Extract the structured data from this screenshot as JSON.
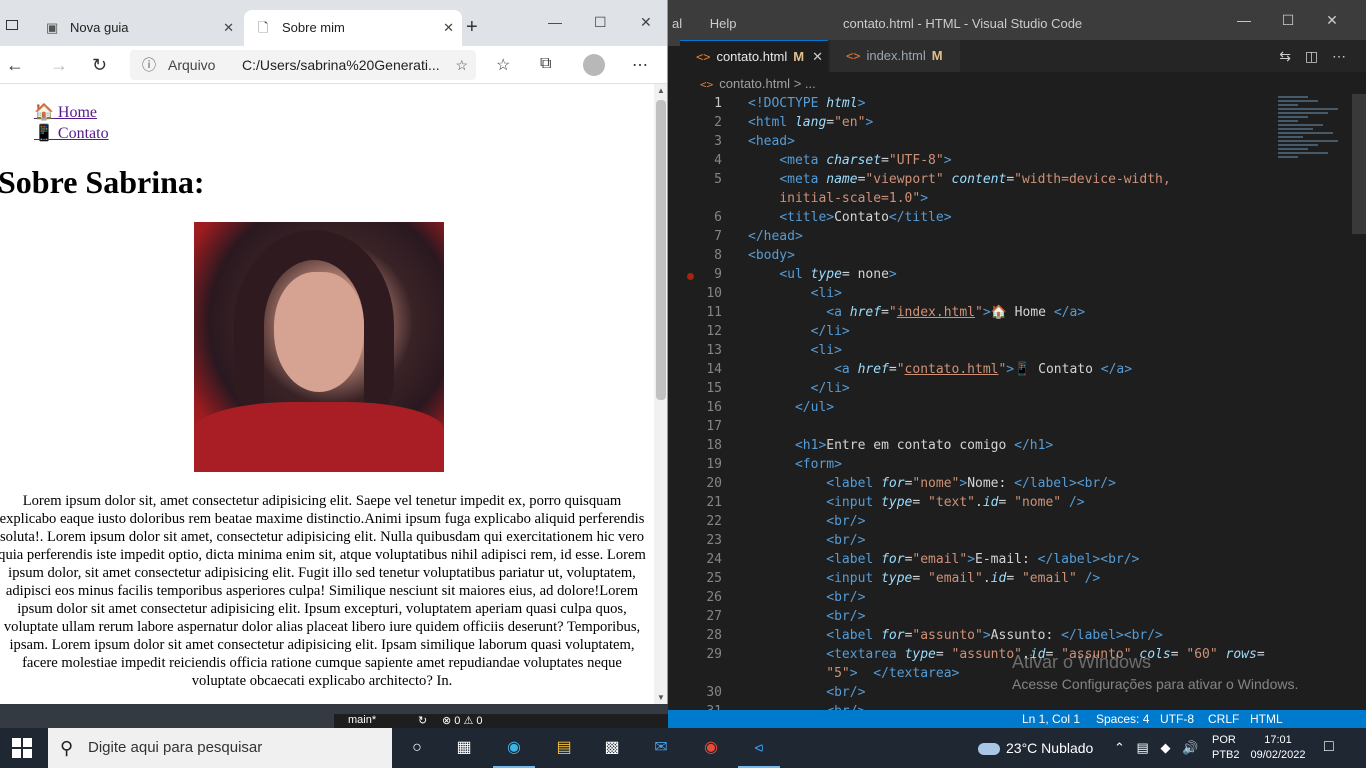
{
  "browser": {
    "tabs": [
      {
        "label": "Nova guia",
        "icon": "page-icon"
      },
      {
        "label": "Sobre mim",
        "icon": "document-icon"
      }
    ],
    "address": {
      "security_label": "Arquivo",
      "url": "C:/Users/sabrina%20Generati..."
    },
    "page": {
      "nav": [
        {
          "emoji": "🏠",
          "label": " Home"
        },
        {
          "emoji": "📱",
          "label": " Contato"
        }
      ],
      "heading": "Sobre Sabrina:",
      "paragraph": "Lorem ipsum dolor sit, amet consectetur adipisicing elit. Saepe vel tenetur impedit ex, porro quisquam explicabo eaque iusto doloribus rem beatae maxime distinctio.Animi ipsum fuga explicabo aliquid perferendis soluta!. Lorem ipsum dolor sit amet, consectetur adipisicing elit. Nulla quibusdam qui exercitationem hic vero quia perferendis iste impedit optio, dicta minima enim sit, atque voluptatibus nihil adipisci rem, id esse. Lorem ipsum dolor, sit amet consectetur adipisicing elit. Fugit illo sed tenetur voluptatibus pariatur ut, voluptatem, adipisci eos minus facilis temporibus asperiores culpa! Similique nesciunt sit maiores eius, ad dolore!Lorem ipsum dolor sit amet consectetur adipisicing elit. Ipsum excepturi, voluptatem aperiam quasi culpa quos, voluptate ullam rerum labore aspernatur dolor alias placeat libero iure quidem officiis deserunt? Temporibus, ipsam. Lorem ipsum dolor sit amet consectetur adipisicing elit. Ipsam similique laborum quasi voluptatem, facere molestiae impedit reiciendis officia ratione cumque sapiente amet repudiandae voluptates neque voluptate obcaecati explicabo architecto? In."
    }
  },
  "vscode": {
    "menu_partial": "al",
    "menu_help": "Help",
    "title": "contato.html - HTML - Visual Studio Code",
    "tabs": [
      {
        "label": "contato.html",
        "modified": "M"
      },
      {
        "label": "index.html",
        "modified": "M"
      }
    ],
    "breadcrumb": {
      "file": "contato.html",
      "sep": "> ..."
    },
    "watermark_title": "Ativar o Windows",
    "watermark_sub": "Acesse Configurações para ativar o Windows.",
    "status": {
      "branch": "main*",
      "problems": "⊗ 0 ⚠ 0",
      "position": "Ln 1, Col 1",
      "spaces": "Spaces: 4",
      "encoding": "UTF-8",
      "eol": "CRLF",
      "language": "HTML"
    }
  },
  "taskbar": {
    "search_placeholder": "Digite aqui para pesquisar",
    "weather": "23°C  Nublado",
    "lang_line1": "POR",
    "lang_line2": "PTB2",
    "time": "17:01",
    "date": "09/02/2022"
  }
}
